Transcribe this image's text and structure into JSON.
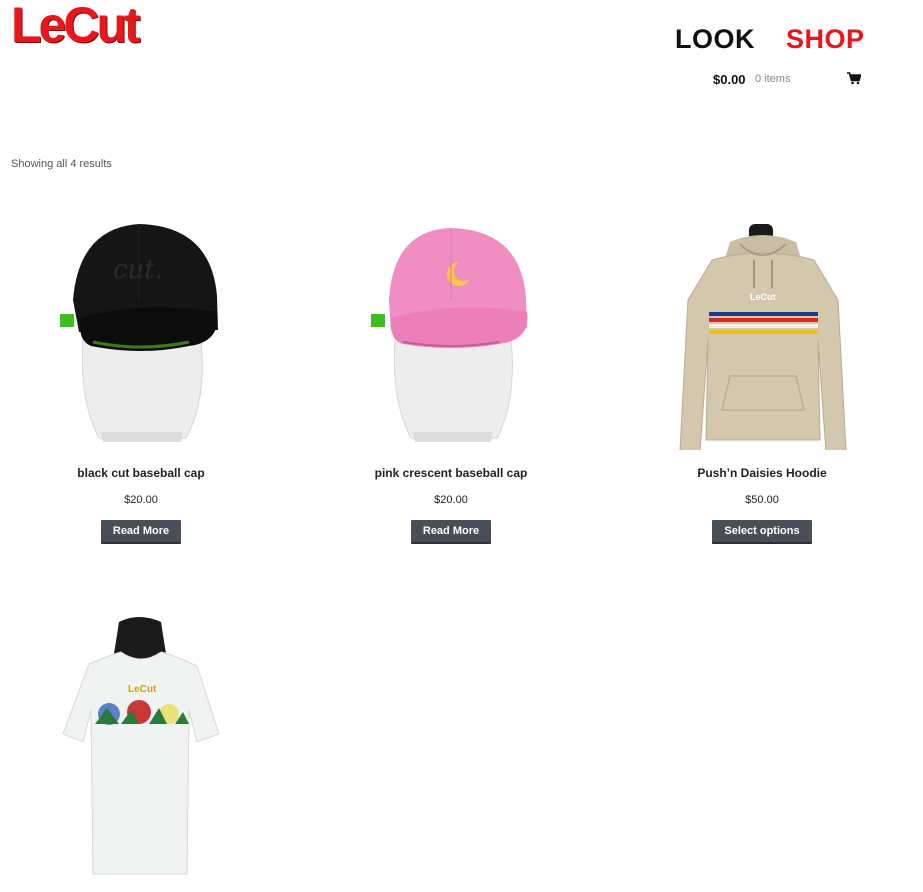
{
  "header": {
    "logo": "LeCut",
    "nav": {
      "look": "LOOK",
      "shop": "SHOP"
    },
    "cart": {
      "total": "$0.00",
      "count": "0 items",
      "icon": "shopping-cart-icon"
    }
  },
  "results_text": "Showing all 4 results",
  "colors": {
    "brand_red": "#e8171b",
    "button_bg": "#4a4e57",
    "nav_black": "#111111"
  },
  "products": [
    {
      "name": "black cut baseball cap",
      "price": "$20.00",
      "button": "Read More",
      "image": "black-baseball-cap-image",
      "print": "cut."
    },
    {
      "name": "pink crescent baseball cap",
      "price": "$20.00",
      "button": "Read More",
      "image": "pink-crescent-cap-image"
    },
    {
      "name": "Push’n Daisies Hoodie",
      "price": "$50.00",
      "button": "Select options",
      "image": "beige-hoodie-image",
      "print": "LeCut"
    },
    {
      "name": "",
      "price": "",
      "button": "",
      "image": "white-tshirt-image",
      "print": "LeCut"
    }
  ]
}
